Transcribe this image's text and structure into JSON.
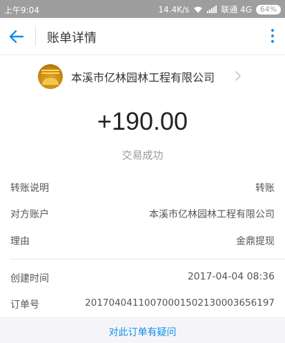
{
  "status_bar": {
    "time": "上午9:04",
    "network_speed": "14.4K/s",
    "carrier": "联通 4G",
    "battery": "64%"
  },
  "navbar": {
    "title": "账单详情",
    "accent_color": "#108ee9"
  },
  "merchant": {
    "name": "本溪市亿林园林工程有限公司"
  },
  "transaction": {
    "amount": "+190.00",
    "status": "交易成功"
  },
  "details": [
    {
      "label": "转账说明",
      "value": "转账"
    },
    {
      "label": "对方账户",
      "value": "本溪市亿林园林工程有限公司"
    },
    {
      "label": "理由",
      "value": "金鼎提现"
    }
  ],
  "order_info": [
    {
      "label": "创建时间",
      "value": "2017-04-04 08:36"
    },
    {
      "label": "订单号",
      "value": "20170404110070001502130003656197"
    }
  ],
  "footer": {
    "question_link": "对此订单有疑问"
  }
}
